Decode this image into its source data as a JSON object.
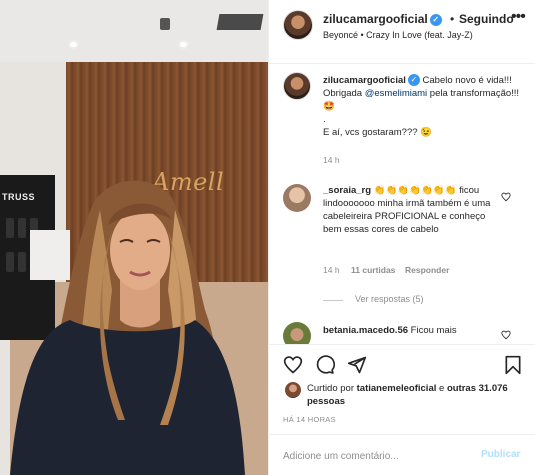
{
  "post": {
    "author": "zilucamargooficial",
    "follow_status": "Seguindo",
    "separator": "•",
    "song": "Beyoncé • Crazy In Love (feat. Jay-Z)",
    "verified_mark": "✓"
  },
  "media": {
    "salon_logo": "Amell",
    "shelf_brand": "TRUSS"
  },
  "caption": {
    "username": "zilucamargooficial",
    "text_part1": "Cabelo novo é vida!!! Obrigada ",
    "mention": "@esmelimiami",
    "text_part2": " pela transformação!!! 🤩",
    "line2": ".",
    "line3": "E aí, vcs gostaram??? 😉",
    "time": "14 h"
  },
  "comments": [
    {
      "username": "_soraia_rg",
      "text": "👏👏👏👏👏👏👏 ficou lindooooooo minha irmã também é uma cabeleireira PROFICIONAL e conheço bem essas cores de cabelo",
      "time": "14 h",
      "likes": "11 curtidas",
      "reply_label": "Responder",
      "view_replies": "Ver respostas (5)"
    },
    {
      "username": "betania.macedo.56",
      "text": "Ficou mais"
    }
  ],
  "actions": {
    "like_icon": "heart-icon",
    "comment_icon": "comment-icon",
    "share_icon": "send-icon",
    "save_icon": "bookmark-icon"
  },
  "likes_summary": {
    "prefix": "Curtido por ",
    "user": "tatianemeleoficial",
    "middle": " e ",
    "others": "outras 31.076 pessoas"
  },
  "timestamp": "HÁ 14 HORAS",
  "comment_box": {
    "placeholder": "Adicione um comentário...",
    "publish_label": "Publicar"
  },
  "colors": {
    "verified": "#3897f0",
    "publish_disabled": "#b2dffc",
    "mention": "#00376b"
  }
}
